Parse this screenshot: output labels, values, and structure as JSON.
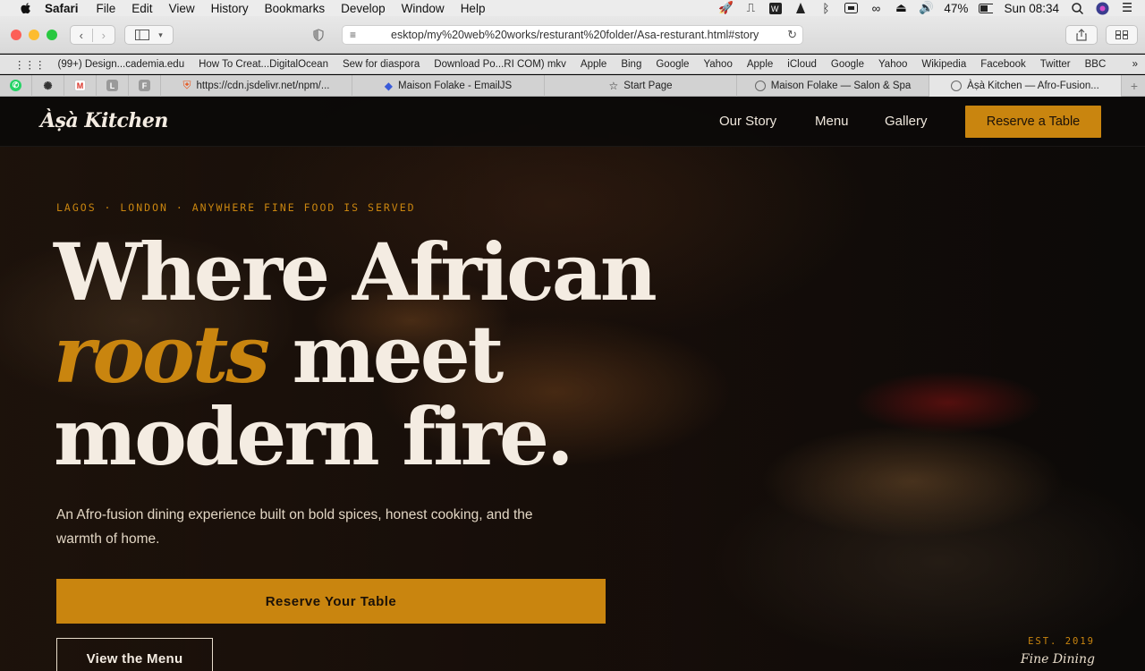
{
  "menubar": {
    "app": "Safari",
    "items": [
      "File",
      "Edit",
      "View",
      "History",
      "Bookmarks",
      "Develop",
      "Window",
      "Help"
    ],
    "battery": "47%",
    "clock": "Sun 08:34"
  },
  "toolbar": {
    "url": "esktop/my%20web%20works/resturant%20folder/Asa-resturant.html#story"
  },
  "bookmarks": [
    "(99+) Design...cademia.edu",
    "How To Creat...DigitalOcean",
    "Sew for diaspora",
    "Download Po...RI COM) mkv",
    "Apple",
    "Bing",
    "Google",
    "Yahoo",
    "Apple",
    "iCloud",
    "Google",
    "Yahoo",
    "Wikipedia",
    "Facebook",
    "Twitter",
    "BBC"
  ],
  "tabs": {
    "pinned": [
      "whatsapp-icon",
      "chatgpt-icon",
      "gmail-icon",
      "L",
      "F"
    ],
    "items": [
      {
        "label": "https://cdn.jsdelivr.net/npm/..."
      },
      {
        "label": "Maison Folake - EmailJS"
      },
      {
        "label": "Start Page"
      },
      {
        "label": "Maison Folake — Salon & Spa"
      },
      {
        "label": "Àṣà Kitchen — Afro-Fusion..."
      }
    ]
  },
  "site": {
    "logo": "Àṣà Kitchen",
    "nav": [
      "Our Story",
      "Menu",
      "Gallery"
    ],
    "cta": "Reserve a Table",
    "eyebrow": "LAGOS · LONDON · ANYWHERE FINE FOOD IS SERVED",
    "headline": {
      "line1": "Where African",
      "italic": "roots",
      "line2_rest": " meet",
      "line3": "modern fire."
    },
    "subcopy": "An Afro-fusion dining experience built on bold spices, honest cooking, and the warmth of home.",
    "primary_button": "Reserve Your Table",
    "secondary_button": "View the Menu",
    "est": "EST. 2019",
    "tagline": "Fine Dining"
  },
  "colors": {
    "accent": "#c9850f",
    "cream": "#f4ece2",
    "dark": "#0d0a08"
  }
}
